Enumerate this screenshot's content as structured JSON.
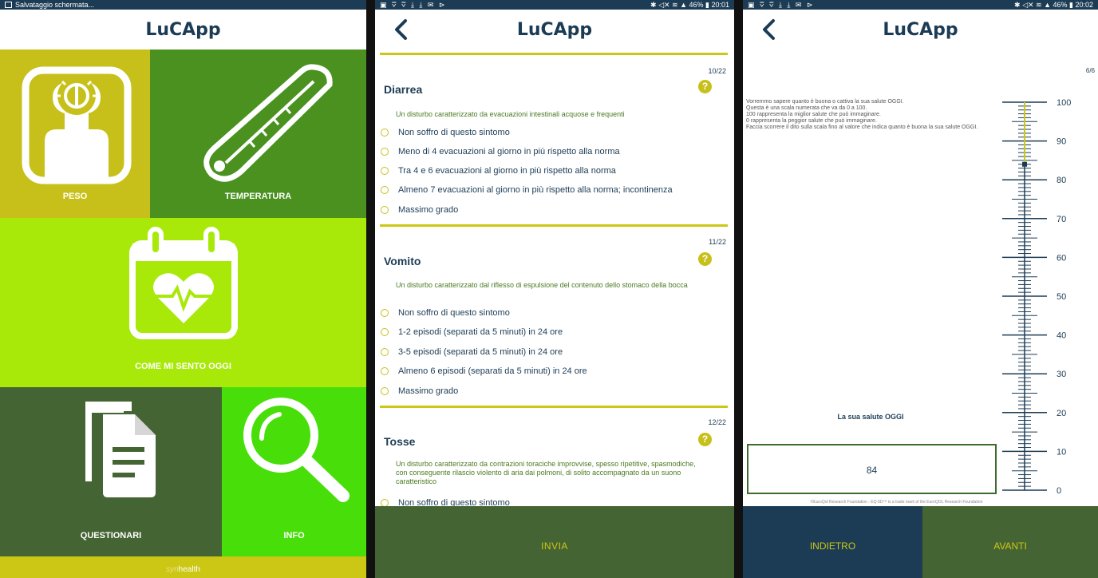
{
  "colors": {
    "navy": "#1c3c55",
    "olive": "#c8c01a",
    "green": "#4a9120",
    "lime": "#a8e90a",
    "darkgreen": "#456434",
    "brightgreen": "#48de0a",
    "yellow": "#ccc714"
  },
  "screen1": {
    "status": {
      "notification": "Salvataggio schermata..."
    },
    "app_title": "LuCApp",
    "tiles": {
      "peso": {
        "label": "PESO",
        "icon": "scale-icon"
      },
      "temperatura": {
        "label": "TEMPERATURA",
        "icon": "thermometer-icon"
      },
      "come": {
        "label": "COME MI SENTO OGGI",
        "icon": "calendar-heart-icon"
      },
      "questionari": {
        "label": "QUESTIONARI",
        "icon": "documents-icon"
      },
      "info": {
        "label": "INFO",
        "icon": "magnifier-icon"
      }
    },
    "footer": {
      "prefix": "syn",
      "brand": "health"
    }
  },
  "screen2": {
    "status": {
      "icons": "▣ ⩢ ⩢ ⤓ ⤓ ✉ ⊳",
      "system": "✱ ◁✕ ≋ ▲ 46% ▮ 20:01"
    },
    "app_title": "LuCApp",
    "questions": [
      {
        "number": "10/22",
        "title": "Diarrea",
        "description": "Un disturbo caratterizzato da evacuazioni intestinali acquose e frequenti",
        "options": [
          "Non soffro di questo sintomo",
          "Meno di 4 evacuazioni al giorno in più rispetto alla norma",
          "Tra 4 e 6 evacuazioni al giorno in più rispetto alla norma",
          "Almeno 7 evacuazioni al giorno in più rispetto alla norma; incontinenza",
          "Massimo grado"
        ]
      },
      {
        "number": "11/22",
        "title": "Vomito",
        "description": "Un disturbo caratterizzato dal riflesso di espulsione del contenuto dello stomaco della bocca",
        "options": [
          "Non soffro di questo sintomo",
          "1-2 episodi (separati da 5 minuti) in 24 ore",
          "3-5 episodi (separati da 5 minuti) in 24 ore",
          "Almeno 6 episodi (separati da 5 minuti) in 24 ore",
          "Massimo grado"
        ]
      },
      {
        "number": "12/22",
        "title": "Tosse",
        "description": "Un disturbo caratterizzato da contrazioni toraciche improvvise, spesso ripetitive, spasmodiche, con conseguente rilascio violento di aria dai polmoni, di solito accompagnato da un suono caratteristico",
        "options": [
          "Non soffro di questo sintomo"
        ]
      }
    ],
    "send_label": "INVIA"
  },
  "screen3": {
    "status": {
      "icons": "▣ ⩢ ⩢ ⤓ ⤓ ✉ ⊳",
      "system": "✱ ◁✕ ≋ ▲ 46% ▮ 20:02"
    },
    "app_title": "LuCApp",
    "page_count": "6/6",
    "intro_lines": [
      "Vorremmo sapere quanto è buona o cattiva la sua salute OGGI.",
      "Questa è una scala numerata che va da 0 a 100.",
      "100 rappresenta la miglior salute che può immaginare.",
      "0 rappresenta la peggior salute che può immaginare.",
      "Faccia scorrere il dito sulla scala fino al valore che indica quanto è buona la sua salute OGGI."
    ],
    "health_label": "La sua salute OGGI",
    "value": "84",
    "scale_labels": [
      "100",
      "90",
      "80",
      "70",
      "60",
      "50",
      "40",
      "30",
      "20",
      "10",
      "0"
    ],
    "copyright": "©EuroQol Research Foundation - EQ-5D™ is a trade mark of the EuroQOL Research Foundation",
    "back_label": "INDIETRO",
    "next_label": "AVANTI"
  }
}
